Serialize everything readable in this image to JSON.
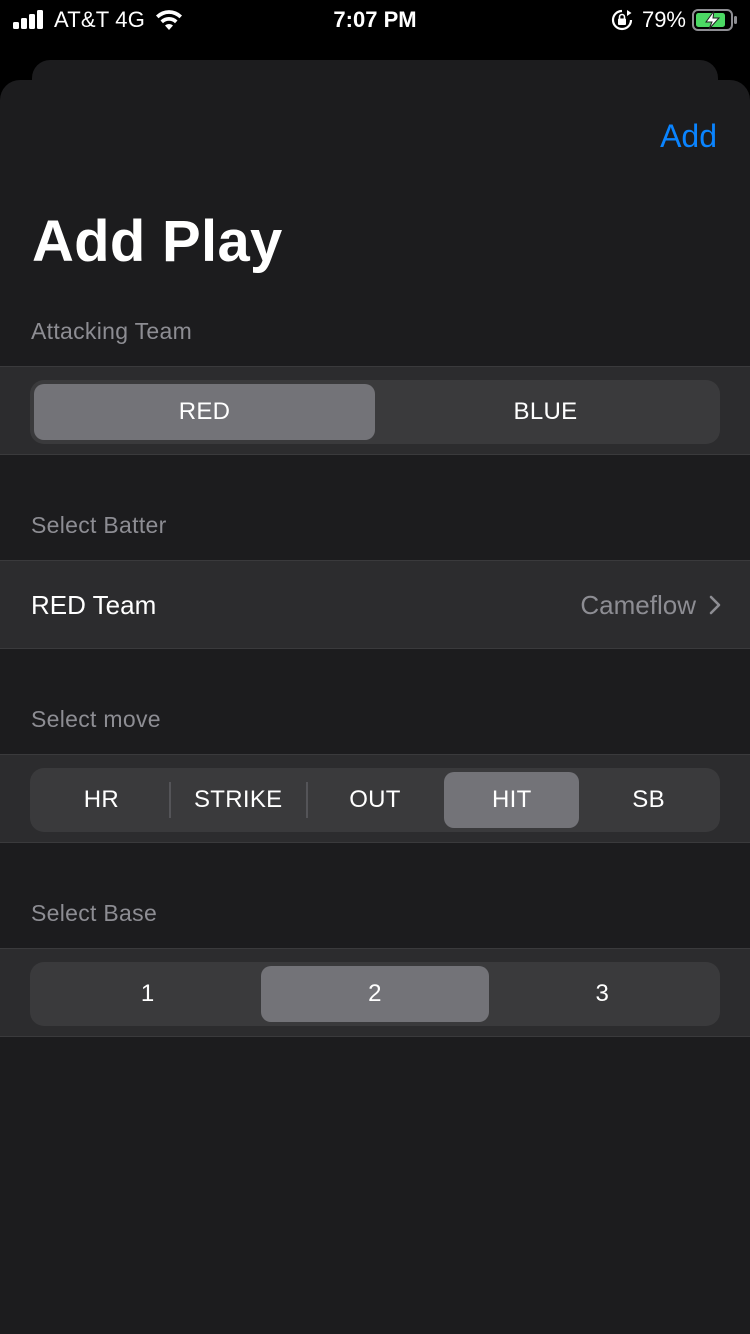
{
  "status_bar": {
    "carrier": "AT&T 4G",
    "time": "7:07 PM",
    "battery_percent": "79%",
    "icons": [
      "signal-icon",
      "wifi-icon",
      "orientation-lock-icon",
      "battery-charging-icon"
    ]
  },
  "nav": {
    "add_label": "Add",
    "accent_color": "#0a84ff"
  },
  "title": "Add Play",
  "attacking_team": {
    "header": "Attacking Team",
    "options": [
      "RED",
      "BLUE"
    ],
    "selected": "RED"
  },
  "batter": {
    "header": "Select Batter",
    "label": "RED Team",
    "value": "Cameflow"
  },
  "move": {
    "header": "Select move",
    "options": [
      "HR",
      "STRIKE",
      "OUT",
      "HIT",
      "SB"
    ],
    "selected": "HIT"
  },
  "base": {
    "header": "Select Base",
    "options": [
      "1",
      "2",
      "3"
    ],
    "selected": "2"
  }
}
